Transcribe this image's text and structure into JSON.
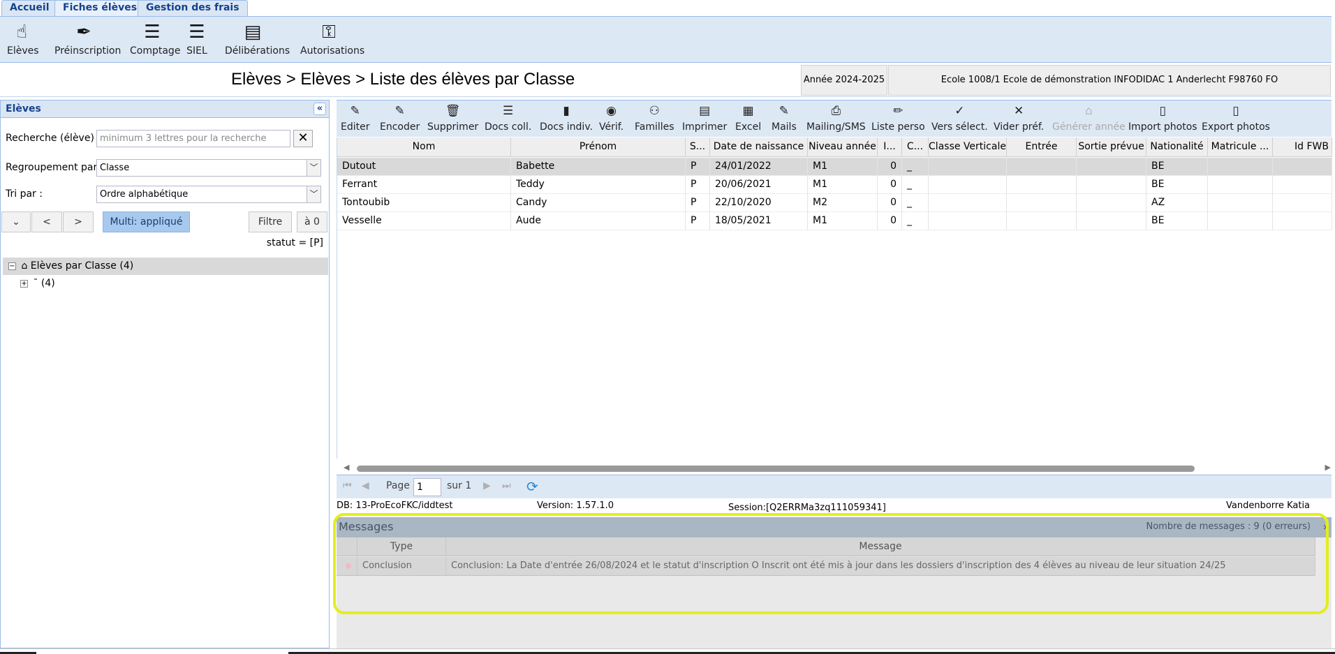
{
  "tabs": [
    {
      "label": "Accueil"
    },
    {
      "label": "Fiches élèves"
    },
    {
      "label": "Gestion des frais"
    }
  ],
  "main_toolbar": [
    {
      "label": "Elèves",
      "icon": "hand-pointer-icon"
    },
    {
      "label": "Préinscription",
      "icon": "pen-nib-icon"
    },
    {
      "label": "Comptage",
      "icon": "list-icon"
    },
    {
      "label": "SIEL",
      "icon": "list-icon"
    },
    {
      "label": "Délibérations",
      "icon": "document-icon"
    },
    {
      "label": "Autorisations",
      "icon": "key-icon"
    }
  ],
  "breadcrumb": "Elèves > Elèves > Liste des élèves par Classe",
  "year": "Année 2024-2025",
  "school": "Ecole 1008/1 Ecole de démonstration INFODIDAC 1 Anderlecht F98760 FO",
  "left_panel": {
    "title": "Elèves",
    "search_label": "Recherche (élève) :",
    "search_placeholder": "minimum 3 lettres pour la recherche",
    "group_label": "Regroupement par :",
    "group_value": "Classe",
    "sort_label": "Tri par :",
    "sort_value": "Ordre alphabétique",
    "prev_label": "<",
    "next_label": ">",
    "multi_label": "Multi: appliqué",
    "filter_label": "Filtre",
    "reset_label": "à 0",
    "statut": "statut = [P]",
    "tree_root": "Elèves par Classe (4)",
    "tree_child": "¯ (4)"
  },
  "action_toolbar": [
    {
      "label": "Editer",
      "icon": "edit-icon",
      "disabled": false
    },
    {
      "label": "Encoder",
      "icon": "edit-icon",
      "disabled": false
    },
    {
      "label": "Supprimer",
      "icon": "trash-icon",
      "disabled": false
    },
    {
      "label": "Docs coll.",
      "icon": "list-icon",
      "disabled": false
    },
    {
      "label": "Docs indiv.",
      "icon": "notebook-icon",
      "disabled": false
    },
    {
      "label": "Vérif.",
      "icon": "eye-icon",
      "disabled": false
    },
    {
      "label": "Familles",
      "icon": "family-icon",
      "disabled": false
    },
    {
      "label": "Imprimer",
      "icon": "document-icon",
      "disabled": false
    },
    {
      "label": "Excel",
      "icon": "excel-icon",
      "disabled": false
    },
    {
      "label": "Mails",
      "icon": "edit-icon",
      "disabled": false
    },
    {
      "label": "Mailing/SMS",
      "icon": "inbox-icon",
      "disabled": false
    },
    {
      "label": "Liste perso",
      "icon": "pencil-icon",
      "disabled": false
    },
    {
      "label": "Vers sélect.",
      "icon": "check-icon",
      "disabled": false
    },
    {
      "label": "Vider préf.",
      "icon": "close-icon",
      "disabled": false
    },
    {
      "label": "Générer année",
      "icon": "home-icon",
      "disabled": true
    },
    {
      "label": "Import photos",
      "icon": "file-icon",
      "disabled": false
    },
    {
      "label": "Export photos",
      "icon": "file-icon",
      "disabled": false
    }
  ],
  "grid": {
    "columns": [
      "Nom",
      "Prénom",
      "S...",
      "Date de naissance",
      "Niveau année",
      "I...",
      "C...",
      "Classe Verticale",
      "Entrée",
      "Sortie prévue",
      "Nationalité",
      "Matricule ...",
      "Id FWB"
    ],
    "rows": [
      [
        "Dutout",
        "Babette",
        "P",
        "24/01/2022",
        "M1",
        "0",
        "_",
        "",
        "",
        "",
        "BE",
        "",
        ""
      ],
      [
        "Ferrant",
        "Teddy",
        "P",
        "20/06/2021",
        "M1",
        "0",
        "_",
        "",
        "",
        "",
        "BE",
        "",
        ""
      ],
      [
        "Tontoubib",
        "Candy",
        "P",
        "22/10/2020",
        "M2",
        "0",
        "_",
        "",
        "",
        "",
        "AZ",
        "",
        ""
      ],
      [
        "Vesselle",
        "Aude",
        "P",
        "18/05/2021",
        "M1",
        "0",
        "_",
        "",
        "",
        "",
        "BE",
        "",
        ""
      ]
    ]
  },
  "pager": {
    "page_label": "Page",
    "page_value": "1",
    "of_label": "sur 1"
  },
  "status": {
    "db": "DB: 13-ProEcoFKC/iddtest",
    "version": "Version: 1.57.1.0",
    "session": "Session:[Q2ERRMa3zq111059341]",
    "user": "Vandenborre Katia"
  },
  "messages": {
    "title": "Messages",
    "count": "Nombre de messages : 9 (0 erreurs)",
    "col_type": "Type",
    "col_message": "Message",
    "row_type": "Conclusion",
    "row_message": "Conclusion: La Date d'entrée 26/08/2024 et le statut d'inscription O Inscrit ont été mis à jour dans les dossiers d'inscription des 4 élèves au niveau de leur situation 24/25"
  },
  "colors": {
    "toolbar_bg": "#dde8f5",
    "accent": "#15428b",
    "highlight": "#e3ee1d"
  }
}
